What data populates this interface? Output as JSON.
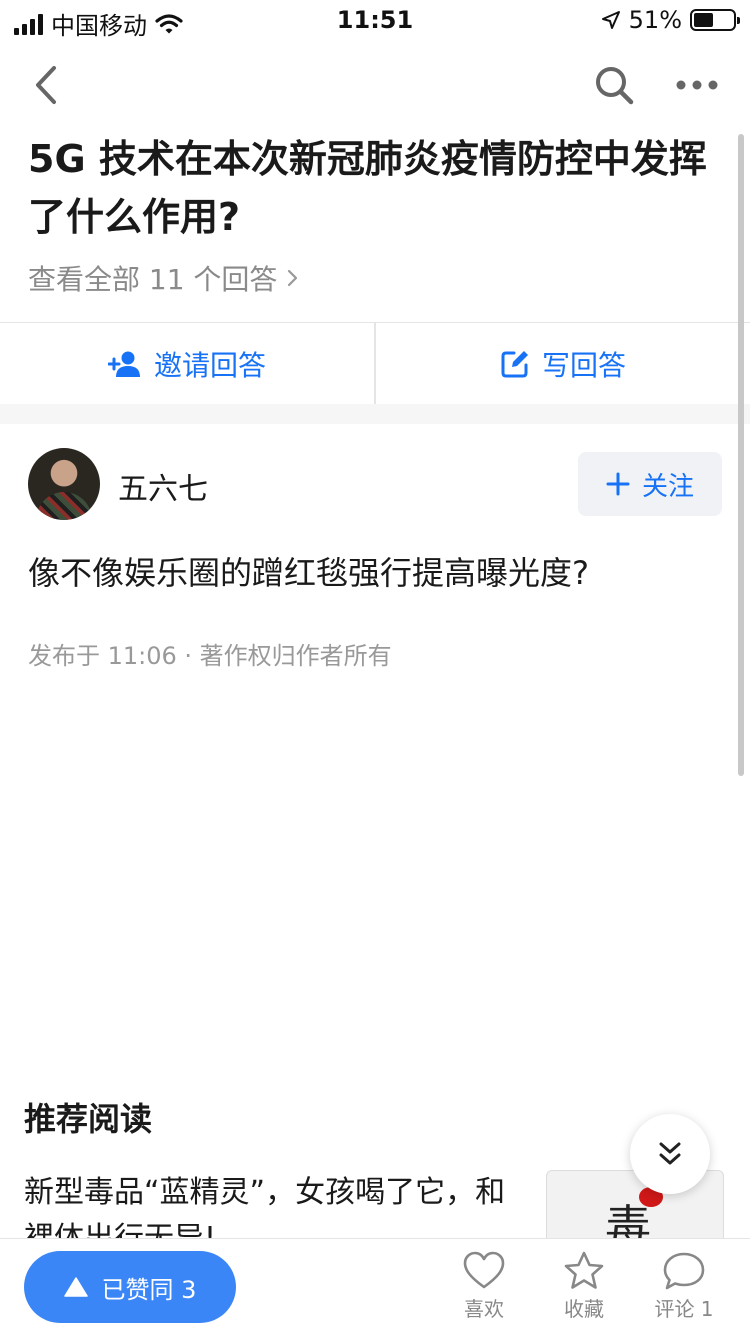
{
  "status_bar": {
    "carrier": "中国移动",
    "time": "11:51",
    "battery": "51%",
    "battery_level": 0.51
  },
  "question": {
    "title": "5G 技术在本次新冠肺炎疫情防控中发挥了什么作用?",
    "view_all": "查看全部 11 个回答"
  },
  "actions": {
    "invite": "邀请回答",
    "write": "写回答"
  },
  "answer": {
    "author": "五六七",
    "follow": "关注",
    "text": "像不像娱乐圈的蹭红毯强行提高曝光度?",
    "meta": "发布于 11:06 · 著作权归作者所有"
  },
  "recommend": {
    "heading": "推荐阅读",
    "item_title": "新型毒品“蓝精灵”，女孩喝了它，和裸体出行无异!",
    "thumb_glyph": "毒"
  },
  "bottom_bar": {
    "upvote": "已赞同 3",
    "like": "喜欢",
    "favorite": "收藏",
    "comment": "评论 1"
  },
  "colors": {
    "accent": "#1772f6",
    "upvote_bg": "#3b86f7"
  }
}
